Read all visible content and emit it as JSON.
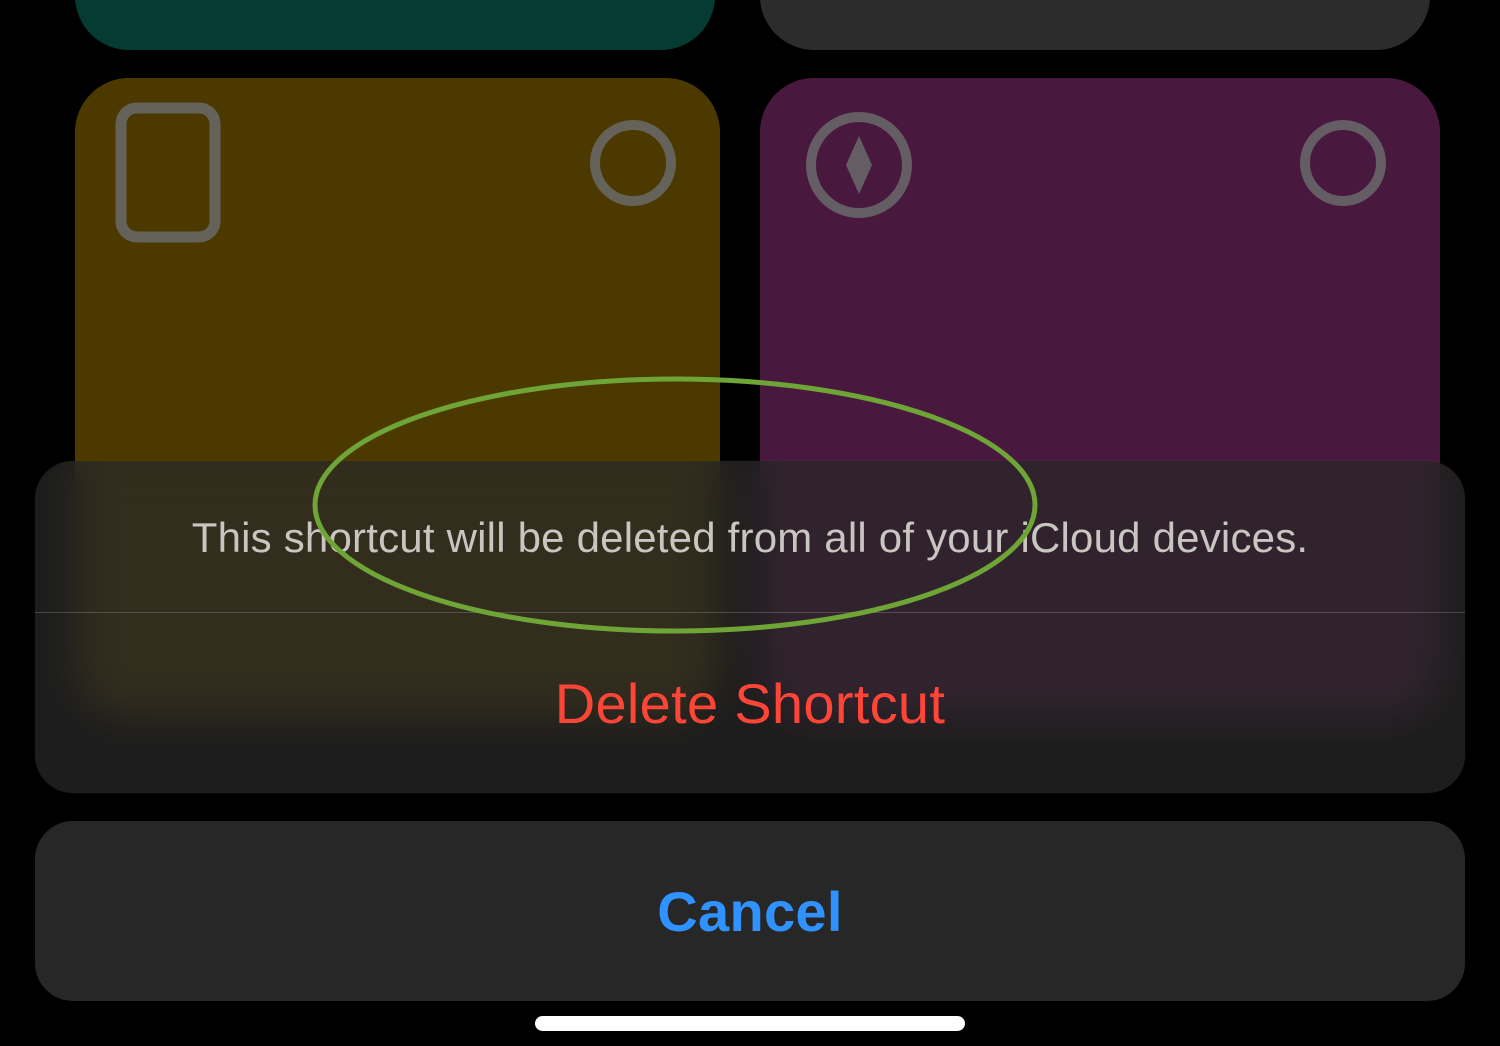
{
  "background": {
    "tiles": [
      {
        "color": "teal",
        "icon": null
      },
      {
        "color": "gray",
        "icon": null
      },
      {
        "color": "yellow",
        "icon": "ipad-icon"
      },
      {
        "color": "magenta",
        "icon": "compass-icon"
      }
    ]
  },
  "action_sheet": {
    "message": "This shortcut will be deleted from all of your iCloud devices.",
    "destructive_label": "Delete Shortcut",
    "cancel_label": "Cancel"
  },
  "annotation": {
    "highlight_target": "delete-shortcut-button",
    "color": "#6fa536"
  }
}
